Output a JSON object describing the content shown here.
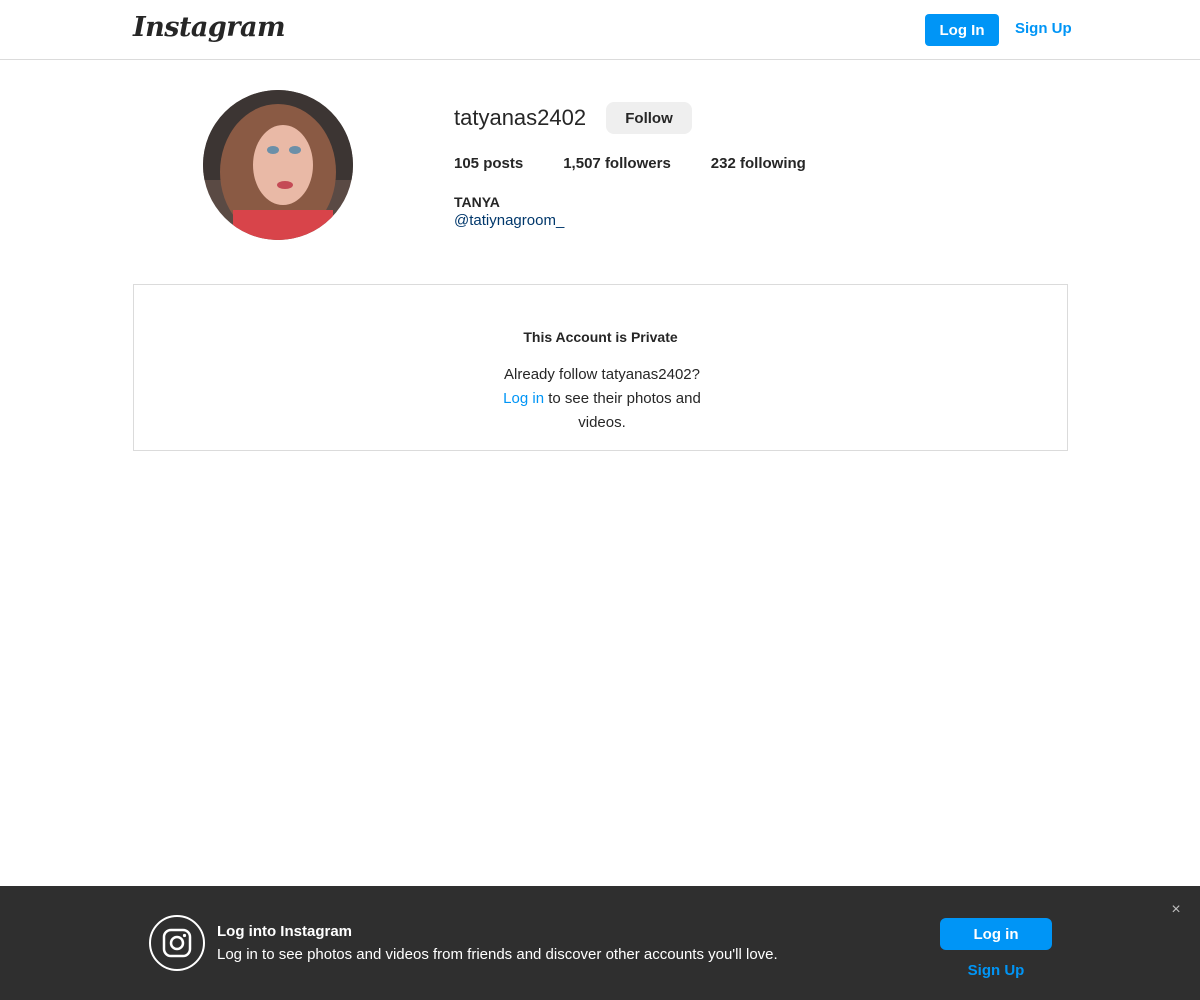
{
  "header": {
    "logo_text": "Instagram",
    "login_label": "Log In",
    "signup_label": "Sign Up"
  },
  "profile": {
    "username": "tatyanas2402",
    "follow_label": "Follow",
    "stats": {
      "posts_count": "105",
      "posts_label": "posts",
      "followers_count": "1,507",
      "followers_label": "followers",
      "following_count": "232",
      "following_label": "following"
    },
    "full_name": "TANYA",
    "bio_handle": "@tatiynagroom_"
  },
  "private_notice": {
    "title": "This Account is Private",
    "msg_prefix": "Already follow tatyanas2402?",
    "msg_link": "Log in",
    "msg_suffix": "to see their photos and videos."
  },
  "banner": {
    "icon": "instagram-icon",
    "title": "Log into Instagram",
    "subtitle": "Log in to see photos and videos from friends and discover other accounts you'll love.",
    "login_label": "Log in",
    "signup_label": "Sign Up",
    "close_glyph": "×"
  },
  "colors": {
    "accent": "#0095f6",
    "banner_bg": "#2f2f2f",
    "border": "#dbdbdb",
    "link_dark": "#00376b"
  }
}
